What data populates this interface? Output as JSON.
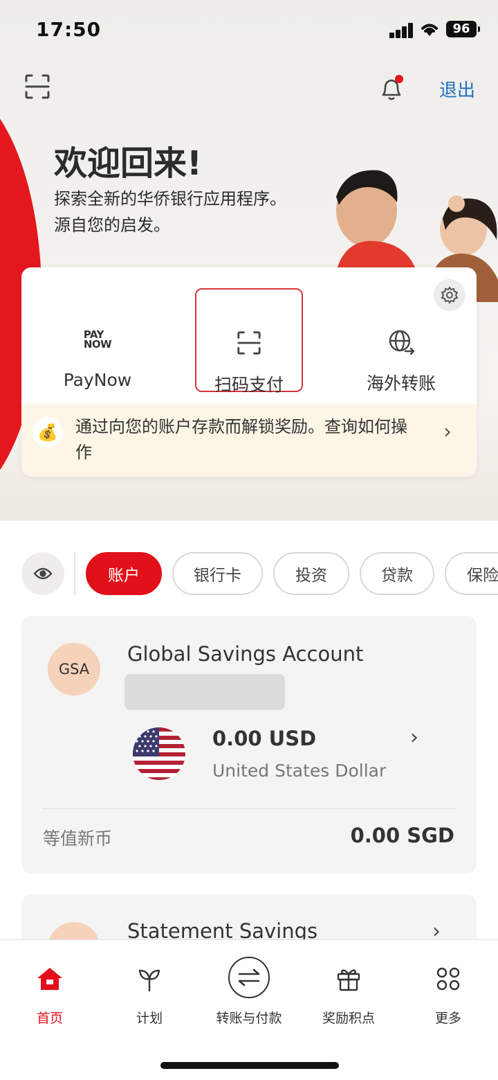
{
  "status_bar": {
    "time": "17:50",
    "battery": "96"
  },
  "header": {
    "logout_label": "退出"
  },
  "hero": {
    "title": "欢迎回来!",
    "subtitle_line1": "探索全新的华侨银行应用程序。",
    "subtitle_line2": "源自您的启发。"
  },
  "quick_actions": [
    {
      "label": "PayNow",
      "icon": "paynow-logo"
    },
    {
      "label": "扫码支付",
      "icon": "scan-icon",
      "selected": true
    },
    {
      "label": "海外转账",
      "icon": "globe-transfer-icon"
    }
  ],
  "paynow_logo": {
    "line1": "PAY",
    "line2": "NOW"
  },
  "promo": {
    "text": "通过向您的账户存款而解锁奖励。查询如何操作"
  },
  "tabs": [
    {
      "label": "账户",
      "active": true
    },
    {
      "label": "银行卡"
    },
    {
      "label": "投资"
    },
    {
      "label": "贷款"
    },
    {
      "label": "保险"
    }
  ],
  "accounts": [
    {
      "avatar": "GSA",
      "name": "Global Savings Account",
      "balance": "0.00 USD",
      "currency_name": "United States Dollar",
      "equivalent_label": "等值新币",
      "equivalent_value": "0.00 SGD"
    },
    {
      "name": "Statement Savings"
    }
  ],
  "bottom_nav": [
    {
      "label": "首页",
      "icon": "home-icon",
      "active": true
    },
    {
      "label": "计划",
      "icon": "sprout-icon"
    },
    {
      "label": "转账与付款",
      "icon": "transfer-icon"
    },
    {
      "label": "奖励积点",
      "icon": "gift-icon"
    },
    {
      "label": "更多",
      "icon": "more-grid-icon"
    }
  ],
  "colors": {
    "brand_red": "#e2101a",
    "link_blue": "#2170c1",
    "promo_bg": "#fdf5e6"
  }
}
